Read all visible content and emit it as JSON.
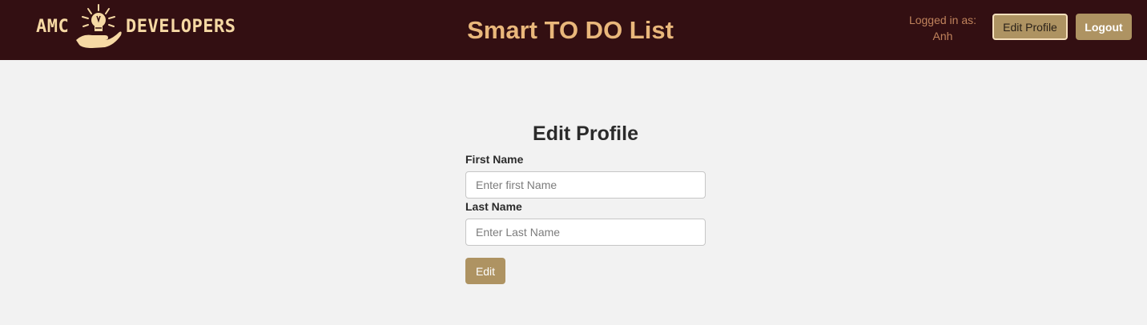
{
  "header": {
    "logo": {
      "text_left": "AMC",
      "text_right": "DEVELOPERS",
      "icon": "lightbulb-hand-icon"
    },
    "app_title": "Smart TO DO List",
    "logged_in_label": "Logged in as:",
    "username": "Anh",
    "edit_profile_label": "Edit Profile",
    "logout_label": "Logout"
  },
  "form": {
    "title": "Edit Profile",
    "first_name": {
      "label": "First Name",
      "value": "",
      "placeholder": "Enter first Name"
    },
    "last_name": {
      "label": "Last Name",
      "value": "",
      "placeholder": "Enter Last Name"
    },
    "submit_label": "Edit"
  },
  "colors": {
    "navbar": "#330f12",
    "accent_button": "#ae9362",
    "title": "#e9b77b",
    "logo": "#f6d9a4",
    "page_background": "#f2f2f2"
  }
}
